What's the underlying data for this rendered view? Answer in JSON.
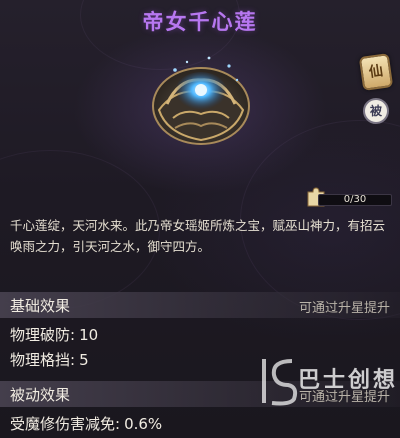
{
  "item": {
    "name": "帝女千心莲",
    "badge_xian": "仙",
    "badge_bei": "被",
    "fragments": {
      "current": 0,
      "required": 30,
      "label": "0/30"
    },
    "description": "千心莲绽，天河水来。此乃帝女瑶姬所炼之宝，赋巫山神力，有招云唤雨之力，引天河之水，御守四方。"
  },
  "base_effects": {
    "title": "基础效果",
    "note": "可通过升星提升",
    "stats": [
      {
        "label": "物理破防:",
        "value": "10"
      },
      {
        "label": "物理格挡:",
        "value": "5"
      }
    ]
  },
  "passive_effects": {
    "title": "被动效果",
    "note": "可通过升星提升",
    "stats": [
      {
        "label": "受魔修伤害减免:",
        "value": "0.6%"
      }
    ]
  },
  "watermark": {
    "text": "巴士创想"
  },
  "colors": {
    "title": "#b777f0",
    "progress_fill": "#c9a45a",
    "gem": "#4fb8ff"
  },
  "icons": [
    "lotus-artifact-icon",
    "immortal-rank-badge-icon",
    "passive-badge-icon",
    "fragment-puzzle-icon",
    "watermark-logo-icon"
  ]
}
